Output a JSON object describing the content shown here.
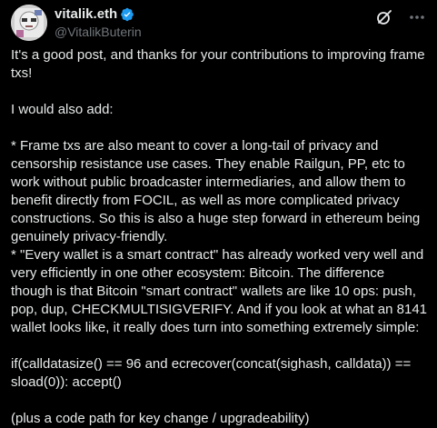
{
  "author": {
    "display_name": "vitalik.eth",
    "handle": "@VitalikButerin",
    "verified": true,
    "verified_color": "#1d9bf0"
  },
  "icons": {
    "verified": "verified-badge-icon",
    "grok": "grok-icon",
    "more": "more-options-icon"
  },
  "post": {
    "p1": "It's a good post, and thanks for your contributions to improving frame txs!",
    "p2": "I would also add:",
    "p3": "* Frame txs are also meant to cover a long-tail of privacy and censorship resistance use cases. They enable Railgun, PP, etc to work without public broadcaster intermediaries, and allow them to benefit directly from FOCIL, as well as more complicated privacy constructions. So this is also a huge step forward in ethereum being genuinely privacy-friendly.",
    "p4": "* \"Every wallet is a smart contract\" has already worked very well and very efficiently in one other ecosystem: Bitcoin. The difference though is that Bitcoin \"smart contract\" wallets are like 10 ops: push, pop, dup, CHECKMULTISIGVERIFY. And if you look at what an 8141 wallet looks like, it really does turn into something extremely simple:",
    "p5": "if(calldatasize() == 96 and ecrecover(concat(sighash, calldata)) == sload(0)): accept()",
    "p6": "(plus a code path for key change / upgradeability)"
  },
  "colors": {
    "background": "#000000",
    "text": "#e7e9ea",
    "secondary": "#71767b"
  }
}
